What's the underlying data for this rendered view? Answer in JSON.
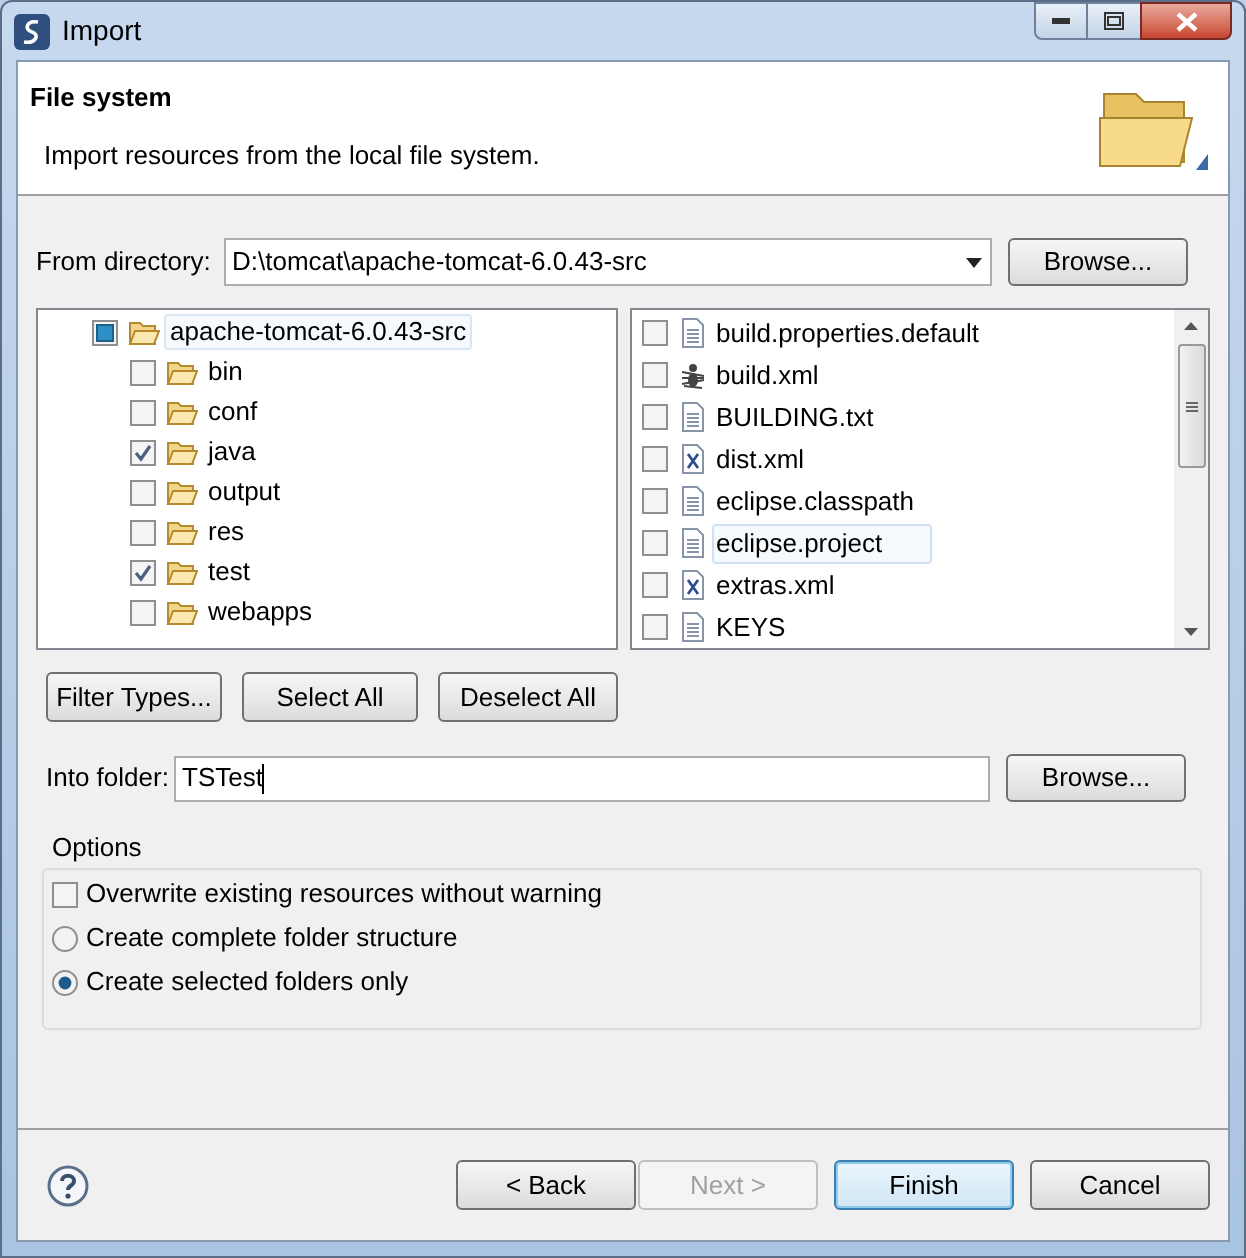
{
  "window": {
    "title": "Import"
  },
  "header": {
    "title": "File system",
    "description": "Import resources from the local file system."
  },
  "from_directory": {
    "label": "From directory:",
    "value": "D:\\tomcat\\apache-tomcat-6.0.43-src",
    "browse": "Browse..."
  },
  "folder_tree": [
    {
      "label": "apache-tomcat-6.0.43-src",
      "checked": true,
      "grayed": true,
      "selected": true,
      "children": [
        {
          "label": "bin",
          "checked": false,
          "grayed": false,
          "selected": false
        },
        {
          "label": "conf",
          "checked": false,
          "grayed": false,
          "selected": false
        },
        {
          "label": "java",
          "checked": true,
          "grayed": false,
          "selected": false
        },
        {
          "label": "output",
          "checked": false,
          "grayed": false,
          "selected": false
        },
        {
          "label": "res",
          "checked": false,
          "grayed": false,
          "selected": false
        },
        {
          "label": "test",
          "checked": true,
          "grayed": false,
          "selected": false
        },
        {
          "label": "webapps",
          "checked": false,
          "grayed": false,
          "selected": false
        }
      ]
    }
  ],
  "files": [
    {
      "label": "build.properties.default",
      "kind": "text",
      "checked": false,
      "selected": false
    },
    {
      "label": "build.xml",
      "kind": "ant",
      "checked": false,
      "selected": false
    },
    {
      "label": "BUILDING.txt",
      "kind": "text",
      "checked": false,
      "selected": false
    },
    {
      "label": "dist.xml",
      "kind": "xml",
      "checked": false,
      "selected": false
    },
    {
      "label": "eclipse.classpath",
      "kind": "text",
      "checked": false,
      "selected": false
    },
    {
      "label": "eclipse.project",
      "kind": "text",
      "checked": false,
      "selected": true
    },
    {
      "label": "extras.xml",
      "kind": "xml",
      "checked": false,
      "selected": false
    },
    {
      "label": "KEYS",
      "kind": "text",
      "checked": false,
      "selected": false
    }
  ],
  "selection_buttons": [
    "Filter Types...",
    "Select All",
    "Deselect All"
  ],
  "into_folder": {
    "label": "Into folder:",
    "value": "TSTest",
    "browse": "Browse..."
  },
  "options": {
    "title": "Options",
    "items": [
      {
        "kind": "checkbox",
        "label": "Overwrite existing resources without warning",
        "checked": false
      },
      {
        "kind": "radio",
        "label": "Create complete folder structure",
        "selected": false
      },
      {
        "kind": "radio",
        "label": "Create selected folders only",
        "selected": true
      }
    ]
  },
  "footer_buttons": [
    {
      "label": "< Back",
      "disabled": false,
      "default": false
    },
    {
      "label": "Next >",
      "disabled": true,
      "default": false
    },
    {
      "label": "Finish",
      "disabled": false,
      "default": true
    },
    {
      "label": "Cancel",
      "disabled": false,
      "default": false
    }
  ]
}
